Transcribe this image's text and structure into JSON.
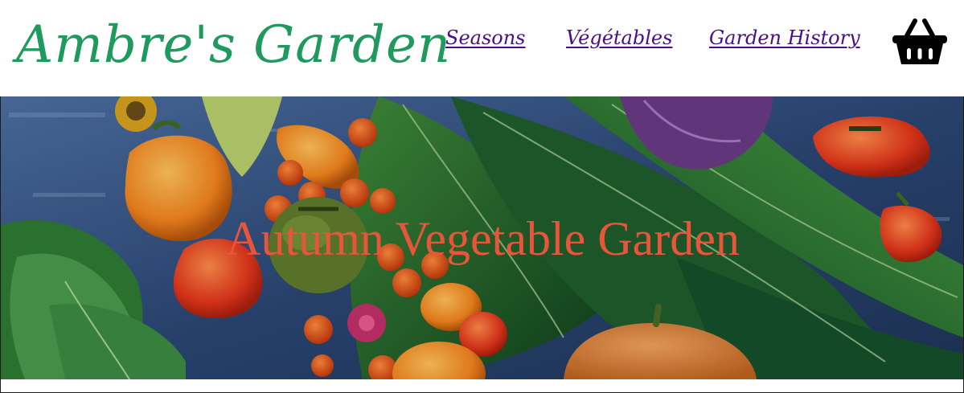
{
  "site": {
    "brand": "Ambre's Garden",
    "brand_color": "#1e9a5c"
  },
  "nav": {
    "link_color": "#4b0e8a",
    "items": [
      {
        "label": "Seasons"
      },
      {
        "label": "Végétables"
      },
      {
        "label": "Garden History"
      }
    ]
  },
  "cart": {
    "icon": "basket-icon"
  },
  "hero": {
    "title": "Autumn Vegetable Garden",
    "title_color": "#e8553a",
    "image": "vegetables-flatlay-image"
  }
}
